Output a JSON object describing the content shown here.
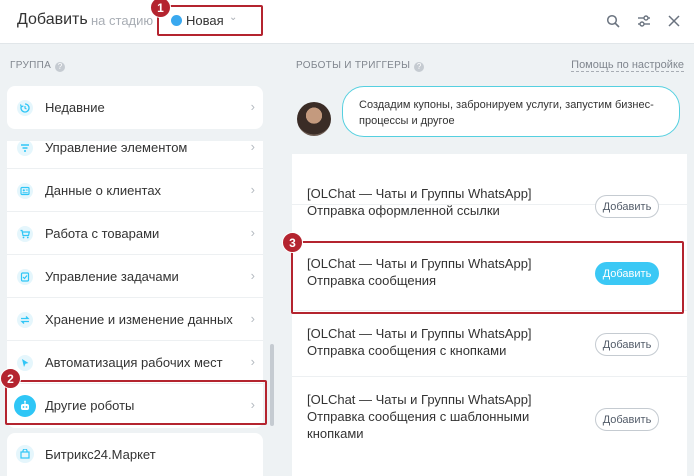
{
  "header": {
    "title": "Добавить",
    "subtitle": "на стадию",
    "stage": {
      "label": "Новая",
      "color": "#39a8ef"
    }
  },
  "badges": [
    "1",
    "2",
    "3"
  ],
  "left": {
    "section_label": "ГРУППА",
    "items": [
      {
        "label": "Недавние",
        "icon": "history-icon"
      },
      {
        "label": "Управление элементом",
        "icon": "filter-icon"
      },
      {
        "label": "Данные о клиентах",
        "icon": "contact-card-icon"
      },
      {
        "label": "Работа с товарами",
        "icon": "cart-icon"
      },
      {
        "label": "Управление задачами",
        "icon": "task-icon"
      },
      {
        "label": "Хранение и изменение данных",
        "icon": "sync-icon"
      },
      {
        "label": "Автоматизация рабочих мест",
        "icon": "cursor-icon"
      },
      {
        "label": "Другие роботы",
        "icon": "robot-icon"
      }
    ],
    "market_label": "Битрикс24.Маркет"
  },
  "right": {
    "section_label": "РОБОТЫ И ТРИГГЕРЫ",
    "help_link": "Помощь по настройке",
    "bubble_text": "Создадим купоны, забронируем услуги, запустим бизнес-процессы и другое",
    "add_label": "Добавить",
    "robots": [
      {
        "line1": "[OLChat — Чаты и Группы WhatsApp]",
        "line2": "Отправка оформленной ссылки",
        "line3": ""
      },
      {
        "line1": "[OLChat — Чаты и Группы WhatsApp]",
        "line2": "Отправка сообщения",
        "line3": ""
      },
      {
        "line1": "[OLChat — Чаты и Группы WhatsApp]",
        "line2": "Отправка сообщения с кнопками",
        "line3": ""
      },
      {
        "line1": "[OLChat — Чаты и Группы WhatsApp]",
        "line2": "Отправка сообщения с шаблонными",
        "line3": "кнопками"
      }
    ]
  },
  "colors": {
    "accent": "#3bc8f5",
    "highlight": "#b4242f"
  }
}
